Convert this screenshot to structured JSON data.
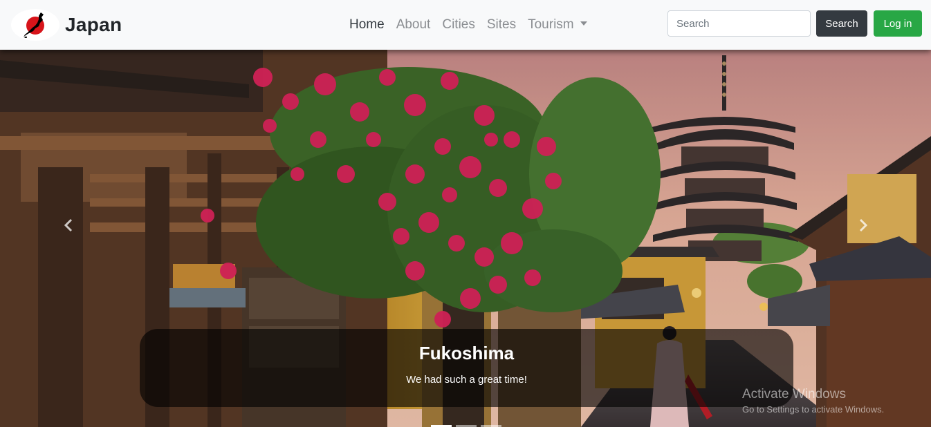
{
  "brand": {
    "name": "Japan",
    "logo_icon": "japan-map-flag-icon"
  },
  "nav": {
    "items": [
      {
        "label": "Home",
        "active": true
      },
      {
        "label": "About",
        "active": false
      },
      {
        "label": "Cities",
        "active": false
      },
      {
        "label": "Sites",
        "active": false
      },
      {
        "label": "Tourism",
        "active": false,
        "dropdown": true
      }
    ]
  },
  "search": {
    "placeholder": "Search",
    "button_label": "Search"
  },
  "login": {
    "label": "Log in"
  },
  "carousel": {
    "image": "Kyoto street with pagoda and flowering tree",
    "caption_title": "Fukoshima",
    "caption_text": "We had such a great time!",
    "slide_count": 3,
    "active_slide": 0
  },
  "watermark": {
    "title": "Activate Windows",
    "subtitle": "Go to Settings to activate Windows."
  },
  "colors": {
    "navbar_bg": "#f8f9fa",
    "search_btn": "#343a40",
    "login_btn": "#28a745",
    "flag_red": "#d7141a"
  }
}
